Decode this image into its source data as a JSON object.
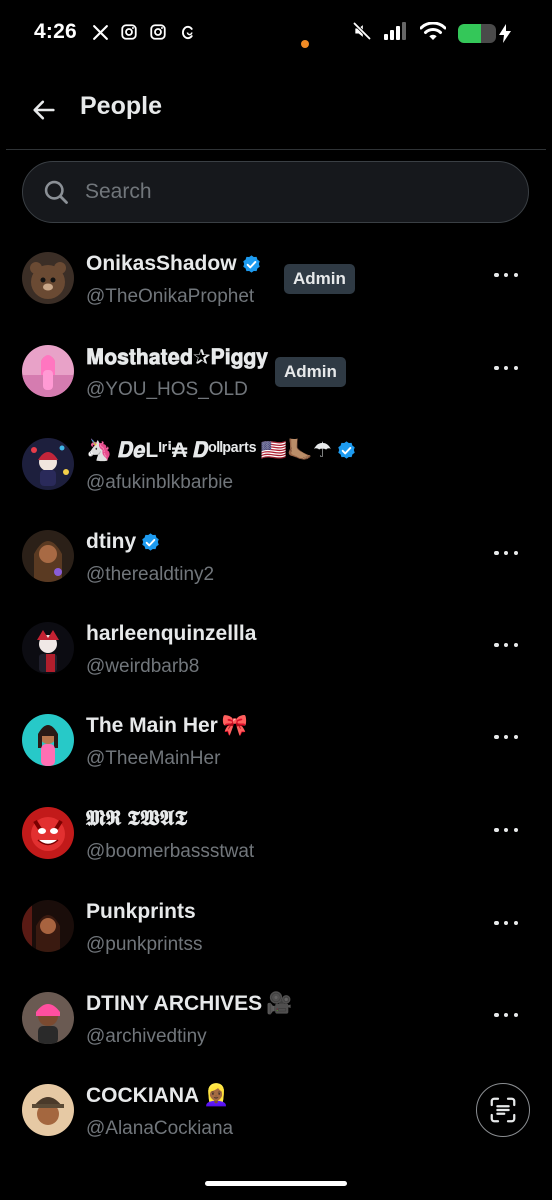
{
  "status_bar": {
    "time": "4:26",
    "left_icons": [
      "x-logo-icon",
      "instagram-icon",
      "instagram-icon",
      "threads-icon"
    ],
    "right_icons": [
      "mute-icon",
      "signal-icon",
      "wifi-icon",
      "battery-icon"
    ],
    "battery_level": 0.6,
    "battery_color": "#34c759"
  },
  "header": {
    "back_icon": "arrow-left-icon",
    "title": "People"
  },
  "search": {
    "placeholder": "Search"
  },
  "people": [
    {
      "name": "OnikasShadow",
      "handle": "@TheOnikaProphet",
      "verified": true,
      "admin": "Admin",
      "emoji": "",
      "has_more": true
    },
    {
      "name": "𝐌𝐨𝐬𝐭𝐡𝐚𝐭𝐞𝐝✰𝐏𝐢𝐠𝐠𝐲",
      "handle": "@YOU_HOS_OLD",
      "verified": false,
      "admin": "Admin",
      "emoji": "",
      "has_more": true
    },
    {
      "name": "🦄 𝑫𝒆Lᴵʳⁱ₳ 𝑫ᵒˡˡᵖᵃʳᵗˢ",
      "handle": "@afukinblkbarbie",
      "verified": true,
      "admin": "",
      "emoji": "🇺🇸🦶🏽☂",
      "has_more": false
    },
    {
      "name": "dtiny",
      "handle": "@therealdtiny2",
      "verified": true,
      "admin": "",
      "emoji": "",
      "has_more": true
    },
    {
      "name": "harleenquinzellla",
      "handle": "@weirdbarb8",
      "verified": false,
      "admin": "",
      "emoji": "",
      "has_more": true
    },
    {
      "name": "The Main Her",
      "handle": "@TheeMainHer",
      "verified": false,
      "admin": "",
      "emoji": "🎀",
      "has_more": true
    },
    {
      "name": "𝕸𝕽 𝕿𝖂𝕬𝕿",
      "handle": "@boomerbassstwat",
      "verified": false,
      "admin": "",
      "emoji": "",
      "has_more": true
    },
    {
      "name": "Punkprints",
      "handle": "@punkprintss",
      "verified": false,
      "admin": "",
      "emoji": "",
      "has_more": true
    },
    {
      "name": "DTINY ARCHIVES",
      "handle": "@archivedtiny",
      "verified": false,
      "admin": "",
      "emoji": "🎥",
      "has_more": true
    },
    {
      "name": "COCKIANA",
      "handle": "@AlanaCockiana",
      "verified": false,
      "admin": "",
      "emoji": "👱🏾‍♀️",
      "has_more": false
    }
  ],
  "colors": {
    "background": "#000000",
    "text_primary": "#e7e9ea",
    "text_secondary": "#71767b",
    "verified_blue": "#1d9bf0",
    "admin_badge_bg": "#2f3a44"
  },
  "floating_button_icon": "scan-text-icon"
}
